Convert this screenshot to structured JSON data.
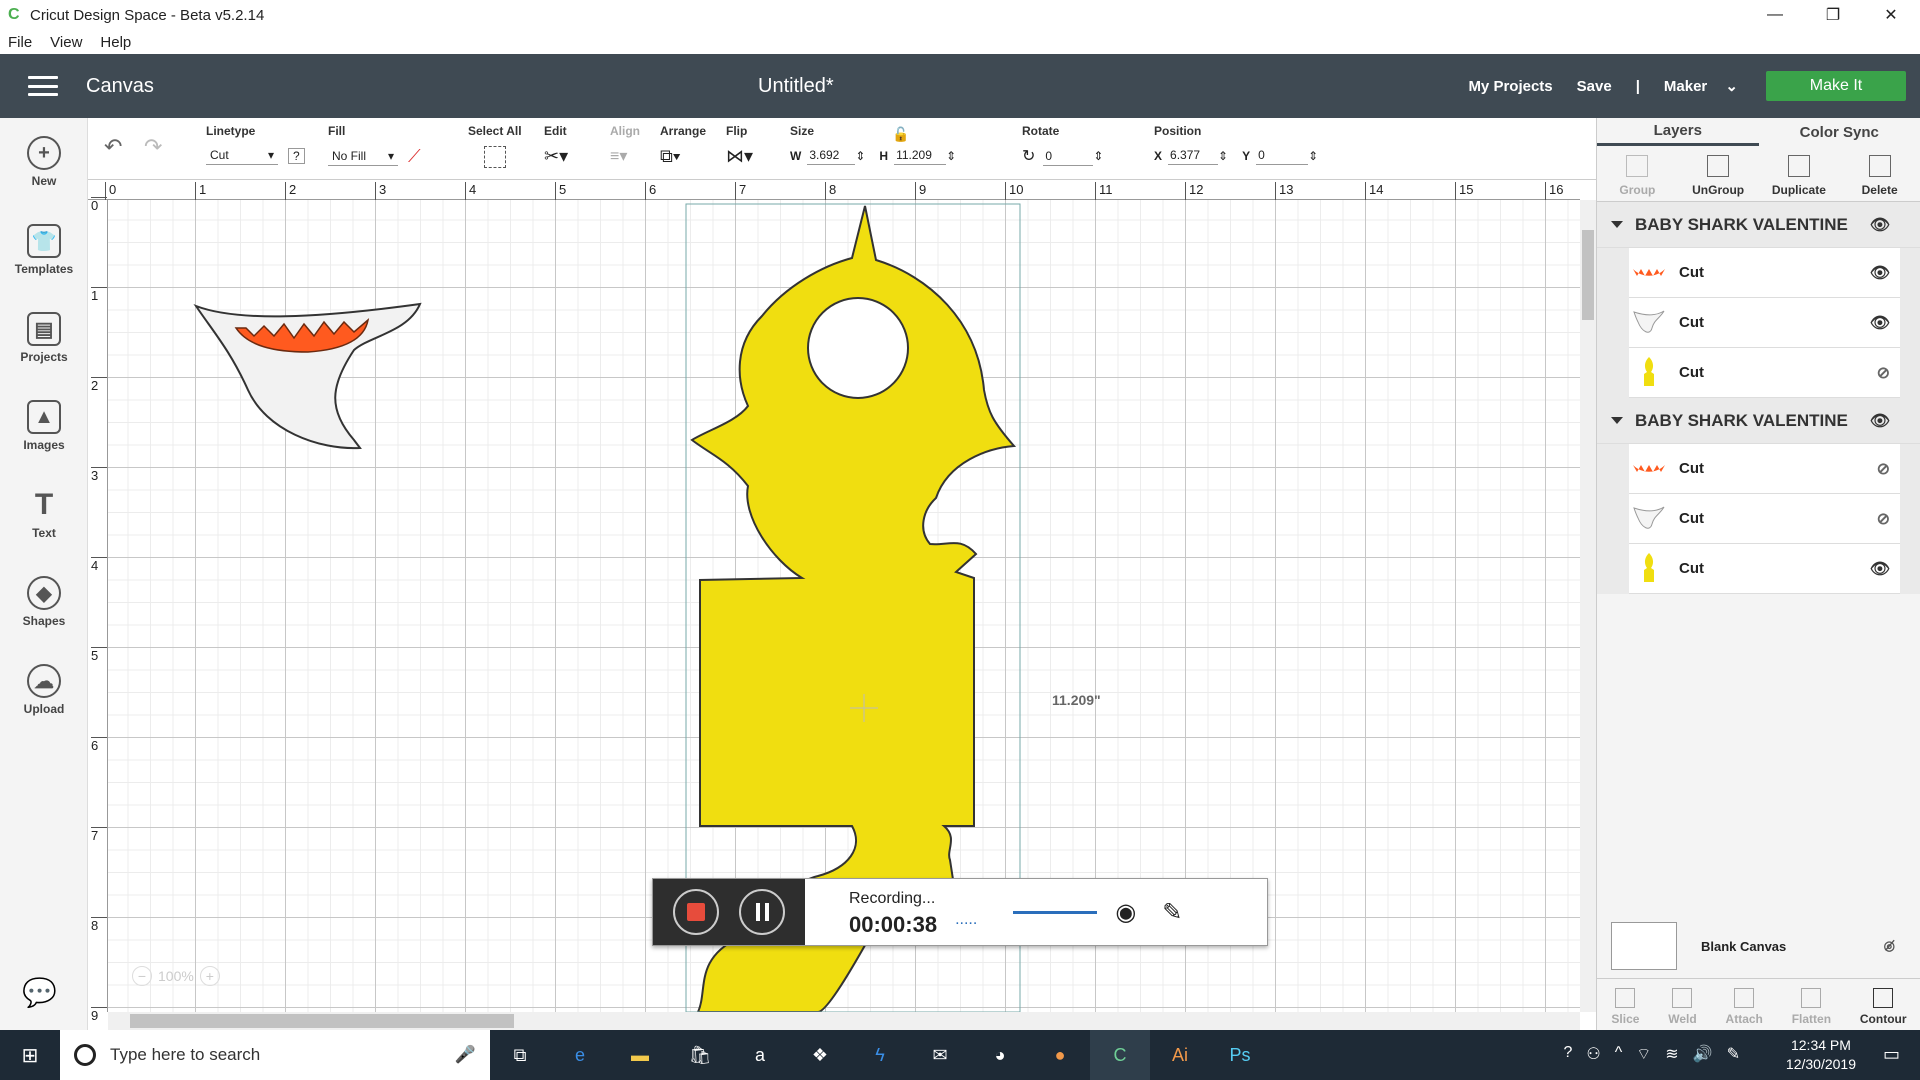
{
  "window": {
    "title": "Cricut Design Space - Beta v5.2.14"
  },
  "menu": [
    "File",
    "View",
    "Help"
  ],
  "header": {
    "canvas_label": "Canvas",
    "doc_title": "Untitled*",
    "my_projects": "My Projects",
    "save": "Save",
    "separator": "|",
    "machine": "Maker",
    "make_it": "Make It"
  },
  "sidebar": [
    "New",
    "Templates",
    "Projects",
    "Images",
    "Text",
    "Shapes",
    "Upload"
  ],
  "toolbar": {
    "linetype_label": "Linetype",
    "linetype_value": "Cut",
    "linetype_help": "?",
    "fill_label": "Fill",
    "fill_value": "No Fill",
    "select_all": "Select All",
    "edit": "Edit",
    "align": "Align",
    "arrange": "Arrange",
    "flip": "Flip",
    "size_label": "Size",
    "w_label": "W",
    "w_value": "3.692",
    "h_label": "H",
    "h_value": "11.209",
    "rotate_label": "Rotate",
    "rotate_value": "0",
    "position_label": "Position",
    "x_label": "X",
    "x_value": "6.377",
    "y_label": "Y",
    "y_value": "0"
  },
  "ruler": {
    "x": [
      "0",
      "1",
      "2",
      "3",
      "4",
      "5",
      "6",
      "7",
      "8",
      "9",
      "10",
      "11",
      "12",
      "13",
      "14",
      "15",
      "16"
    ],
    "y": [
      "0",
      "1",
      "2",
      "3",
      "4",
      "5",
      "6",
      "7",
      "8",
      "9"
    ]
  },
  "canvas": {
    "dimension_label": "11.209\"",
    "zoom": "100%"
  },
  "panel": {
    "tabs": [
      "Layers",
      "Color Sync"
    ],
    "tools_top": [
      "Group",
      "UnGroup",
      "Duplicate",
      "Delete"
    ],
    "groups": [
      {
        "name": "BABY SHARK VALENTINE",
        "layers": [
          {
            "label": "Cut",
            "visible": true,
            "thumb": "teeth"
          },
          {
            "label": "Cut",
            "visible": true,
            "thumb": "mouth"
          },
          {
            "label": "Cut",
            "visible": false,
            "thumb": "body"
          }
        ]
      },
      {
        "name": "BABY SHARK VALENTINE",
        "layers": [
          {
            "label": "Cut",
            "visible": false,
            "thumb": "teeth"
          },
          {
            "label": "Cut",
            "visible": false,
            "thumb": "mouth"
          },
          {
            "label": "Cut",
            "visible": true,
            "thumb": "body"
          }
        ]
      }
    ],
    "blank_canvas": "Blank Canvas",
    "tools_bottom": [
      "Slice",
      "Weld",
      "Attach",
      "Flatten",
      "Contour"
    ]
  },
  "recorder": {
    "status": "Recording...",
    "time": "00:00:38",
    "dots": "....."
  },
  "taskbar": {
    "search_placeholder": "Type here to search",
    "time": "12:34 PM",
    "date": "12/30/2019"
  },
  "colors": {
    "header": "#3f4a53",
    "make_it": "#3aa34a",
    "shark_yellow": "#f0de10",
    "teeth": "#ff5a1f"
  }
}
